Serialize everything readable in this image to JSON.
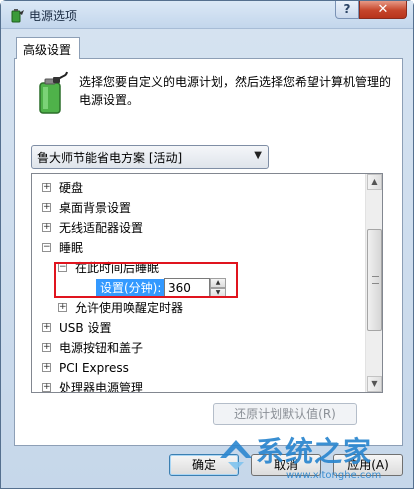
{
  "window": {
    "title": "电源选项",
    "help_label": "?",
    "close_label": "✕"
  },
  "tab": {
    "label": "高级设置"
  },
  "description": "选择您要自定义的电源计划，然后选择您希望计算机管理的电源设置。",
  "plan_select": {
    "value": "鲁大师节能省电方案 [活动]",
    "arrow": "▼"
  },
  "tree": {
    "items": [
      {
        "expander": "+",
        "label": "硬盘"
      },
      {
        "expander": "+",
        "label": "桌面背景设置"
      },
      {
        "expander": "+",
        "label": "无线适配器设置"
      },
      {
        "expander": "−",
        "label": "睡眠"
      },
      {
        "expander": "−",
        "label": "在此时间后睡眠"
      },
      {
        "expander": "+",
        "label": "允许使用唤醒定时器"
      },
      {
        "expander": "+",
        "label": "USB 设置"
      },
      {
        "expander": "+",
        "label": "电源按钮和盖子"
      },
      {
        "expander": "+",
        "label": "PCI Express"
      },
      {
        "expander": "+",
        "label": "处理器电源管理"
      }
    ],
    "setting_label": "设置(分钟):",
    "setting_value": "360",
    "step_up": "▲",
    "step_down": "▼",
    "scroll_up": "▲",
    "scroll_down": "▼"
  },
  "restore_button": "还原计划默认值(R)",
  "buttons": {
    "ok": "确定",
    "cancel": "取消",
    "apply": "应用(A)"
  },
  "watermark": {
    "text": "系统之家",
    "url": "www.xitonghe.com"
  },
  "colors": {
    "selection": "#3399ff",
    "highlight_box": "#e0141e",
    "watermark": "#2a86cf"
  }
}
